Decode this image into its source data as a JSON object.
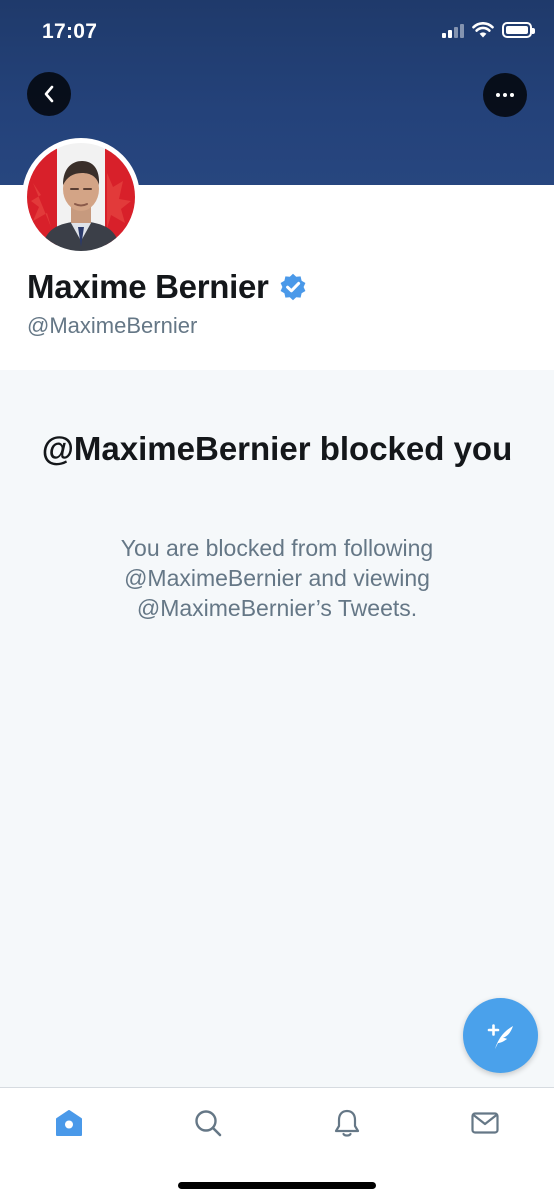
{
  "status_bar": {
    "time": "17:07"
  },
  "profile": {
    "display_name": "Maxime Bernier",
    "handle": "@MaximeBernier",
    "verified": true
  },
  "blocked_notice": {
    "title": "@MaximeBernier blocked you",
    "body": "You are blocked from following @MaximeBernier and viewing @MaximeBernier’s Tweets."
  },
  "colors": {
    "banner": "#24427a",
    "accent": "#4aa1eb",
    "text_primary": "#14171a",
    "text_secondary": "#657786",
    "background": "#f5f8fa"
  },
  "tabbar": {
    "tabs": [
      {
        "icon": "home-icon",
        "active": true
      },
      {
        "icon": "search-icon",
        "active": false
      },
      {
        "icon": "bell-icon",
        "active": false
      },
      {
        "icon": "mail-icon",
        "active": false
      }
    ]
  },
  "fab": {
    "icon": "compose-tweet-icon"
  }
}
